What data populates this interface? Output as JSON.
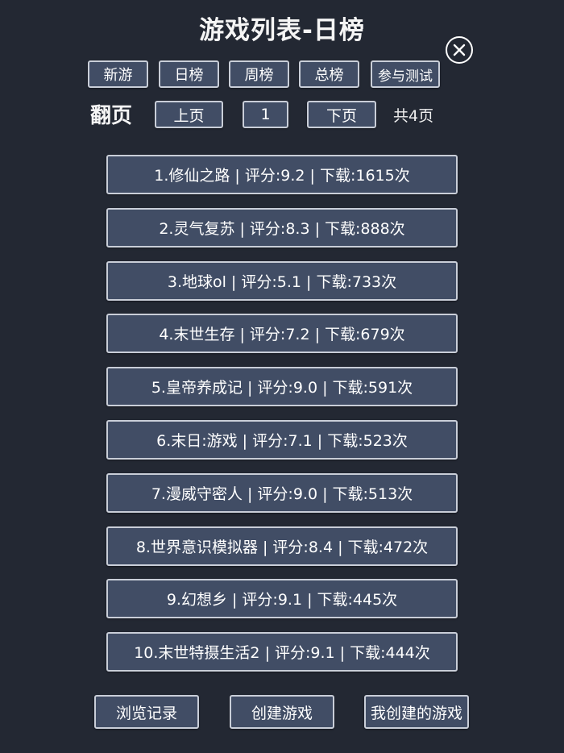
{
  "page": {
    "title": "游戏列表-日榜"
  },
  "tabs": [
    {
      "label": "新游"
    },
    {
      "label": "日榜"
    },
    {
      "label": "周榜"
    },
    {
      "label": "总榜"
    },
    {
      "label": "参与测试"
    }
  ],
  "pagination": {
    "label": "翻页",
    "prev_label": "上页",
    "current_page": "1",
    "next_label": "下页",
    "total_text": "共4页"
  },
  "games": [
    {
      "text": "1.修仙之路 | 评分:9.2 | 下载:1615次"
    },
    {
      "text": "2.灵气复苏 | 评分:8.3 | 下载:888次"
    },
    {
      "text": "3.地球ol | 评分:5.1 | 下载:733次"
    },
    {
      "text": "4.末世生存 | 评分:7.2 | 下载:679次"
    },
    {
      "text": "5.皇帝养成记 | 评分:9.0 | 下载:591次"
    },
    {
      "text": "6.末日:游戏 | 评分:7.1 | 下载:523次"
    },
    {
      "text": "7.漫威守密人 | 评分:9.0 | 下载:513次"
    },
    {
      "text": "8.世界意识模拟器 | 评分:8.4 | 下载:472次"
    },
    {
      "text": "9.幻想乡 | 评分:9.1 | 下载:445次"
    },
    {
      "text": "10.末世特摄生活2 | 评分:9.1 | 下载:444次"
    }
  ],
  "footer": {
    "history_label": "浏览记录",
    "create_label": "创建游戏",
    "my_games_label": "我创建的游戏"
  },
  "icons": {
    "close": "close-icon"
  },
  "colors": {
    "background": "#232833",
    "button_fill": "#414d65",
    "button_border": "#c9ced8",
    "text": "#ffffff"
  }
}
